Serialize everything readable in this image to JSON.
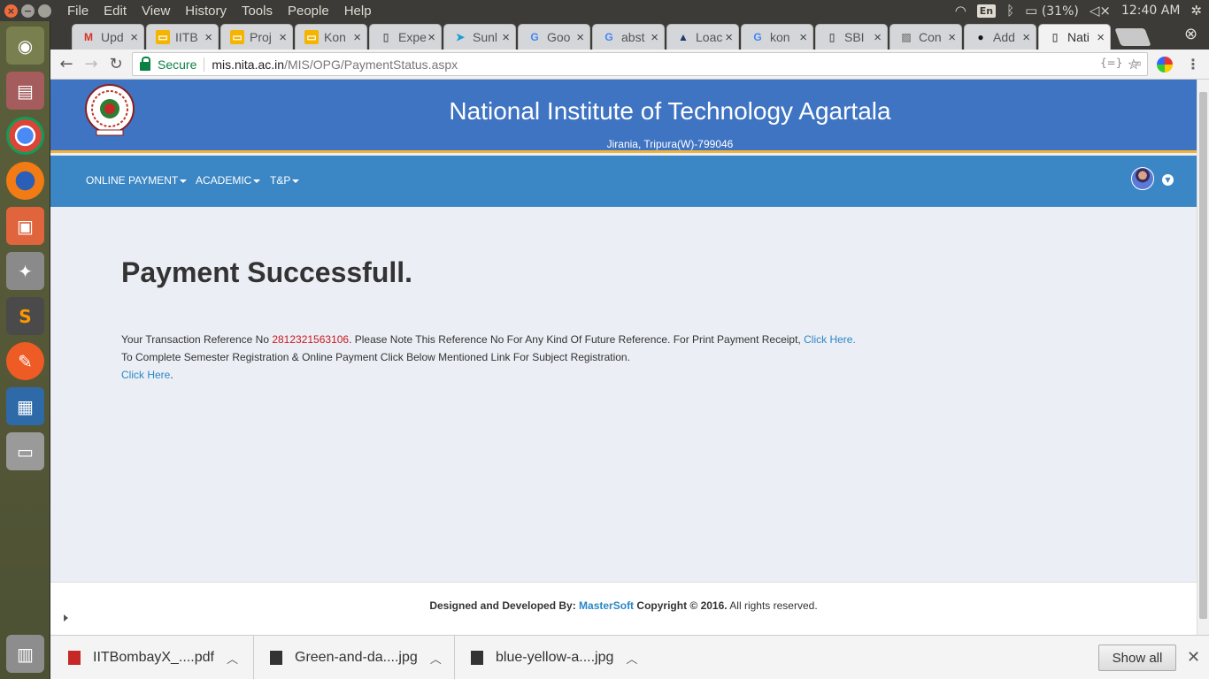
{
  "system": {
    "menu": [
      "File",
      "Edit",
      "View",
      "History",
      "Tools",
      "People",
      "Help"
    ],
    "tray": {
      "lang": "En",
      "battery": "(31%)",
      "time": "12:40 AM"
    }
  },
  "launcher": [
    "ubuntu-icon",
    "files-icon",
    "chrome-icon",
    "firefox-icon",
    "folder-icon",
    "settings-icon",
    "sublime-icon",
    "postman-icon",
    "writer-icon",
    "drive-icon",
    "trash-icon"
  ],
  "tabs": [
    {
      "label": "Upd",
      "icon": "gmail-icon"
    },
    {
      "label": "IITB",
      "icon": "slides-icon"
    },
    {
      "label": "Proj",
      "icon": "slides-icon"
    },
    {
      "label": "Kon",
      "icon": "slides-icon"
    },
    {
      "label": "Expe",
      "icon": "page-icon"
    },
    {
      "label": "Sunl",
      "icon": "bird-icon"
    },
    {
      "label": "Goo",
      "icon": "google-icon"
    },
    {
      "label": "abst",
      "icon": "google-icon"
    },
    {
      "label": "Loac",
      "icon": "arrow-icon"
    },
    {
      "label": "kon",
      "icon": "google-icon"
    },
    {
      "label": "SBI",
      "icon": "page-icon"
    },
    {
      "label": "Con",
      "icon": "image-icon"
    },
    {
      "label": "Add",
      "icon": "github-icon"
    },
    {
      "label": "Nati",
      "icon": "page-icon"
    }
  ],
  "omnibox": {
    "secure_label": "Secure",
    "host": "mis.nita.ac.in",
    "path": "/MIS/OPG/PaymentStatus.aspx"
  },
  "site": {
    "title": "National Institute of Technology Agartala",
    "address": "Jirania, Tripura(W)-799046"
  },
  "nav": {
    "online_payment": "ONLINE PAYMENT",
    "academic": "ACADEMIC",
    "tp": "T&P"
  },
  "content": {
    "heading": "Payment Successfull.",
    "line1_pre": "Your Transaction Reference No ",
    "ref_no": "2812321563106",
    "line1_post": ". Please Note This Reference No For Any Kind Of Future Reference. For Print Payment Receipt, ",
    "line1_link": "Click Here.",
    "line2": "To Complete Semester Registration & Online Payment Click Below Mentioned Link For Subject Registration.",
    "line3_link": "Click Here",
    "line3_post": "."
  },
  "footer": {
    "designed_by": "Designed and Developed By:",
    "brand": "MasterSoft",
    "copyright": "Copyright © 2016.",
    "rights": "All rights reserved."
  },
  "downloads": {
    "items": [
      "IITBombayX_....pdf",
      "Green-and-da....jpg",
      "blue-yellow-a....jpg"
    ],
    "show_all": "Show all"
  }
}
